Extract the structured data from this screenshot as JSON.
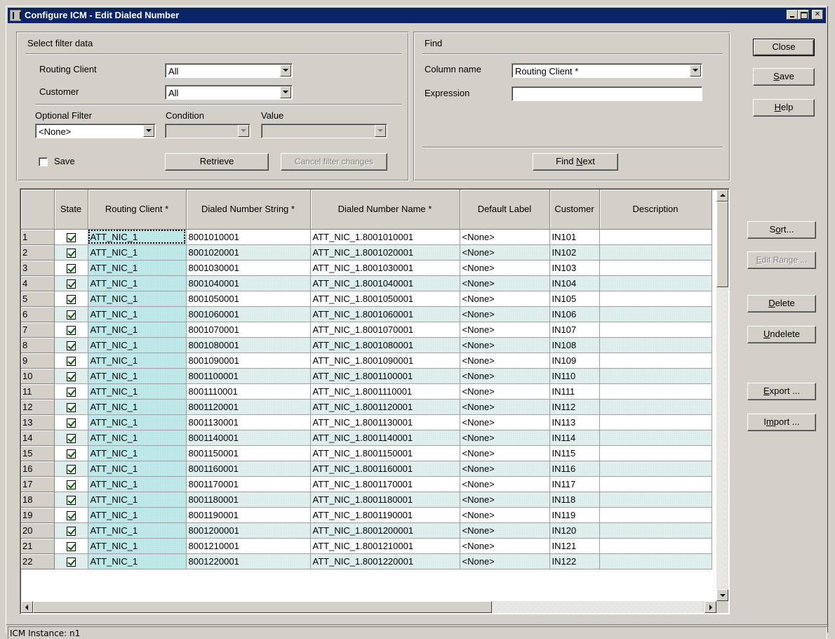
{
  "window": {
    "title": "Configure ICM - Edit Dialed Number"
  },
  "filter": {
    "group_title": "Select filter data",
    "routing_client_label": "Routing Client",
    "routing_client_value": "All",
    "customer_label": "Customer",
    "customer_value": "All",
    "optional_filter_label": "Optional Filter",
    "optional_filter_value": "<None>",
    "condition_label": "Condition",
    "condition_value": "",
    "value_label": "Value",
    "value_value": "",
    "save_label": "Save",
    "retrieve_label": "Retrieve",
    "cancel_label": "Cancel filter changes"
  },
  "find": {
    "group_title": "Find",
    "column_name_label": "Column name",
    "column_name_value": "Routing Client *",
    "expression_label": "Expression",
    "expression_value": "",
    "find_next_pre": "Find ",
    "find_next_u": "N",
    "find_next_post": "ext"
  },
  "actions": {
    "close": "Close",
    "save_u": "S",
    "save_rest": "ave",
    "help_u": "H",
    "help_rest": "elp",
    "sort_pre": "S",
    "sort_u": "o",
    "sort_post": "rt...",
    "edit_range_pre": "",
    "edit_range_u": "E",
    "edit_range_post": "dit Range ...",
    "delete_u": "D",
    "delete_rest": "elete",
    "undelete_u": "U",
    "undelete_rest": "ndelete",
    "export_u": "E",
    "export_rest": "xport ...",
    "import_pre": "I",
    "import_u": "m",
    "import_post": "port ..."
  },
  "grid": {
    "columns": [
      "",
      "State",
      "Routing Client *",
      "Dialed Number String *",
      "Dialed Number Name *",
      "Default Label",
      "Customer",
      "Description"
    ],
    "rows": [
      {
        "n": "1",
        "rc": "ATT_NIC_1",
        "dns": "8001010001",
        "dnn": "ATT_NIC_1.8001010001",
        "label": "<None>",
        "cust": "IN101",
        "desc": ""
      },
      {
        "n": "2",
        "rc": "ATT_NIC_1",
        "dns": "8001020001",
        "dnn": "ATT_NIC_1.8001020001",
        "label": "<None>",
        "cust": "IN102",
        "desc": ""
      },
      {
        "n": "3",
        "rc": "ATT_NIC_1",
        "dns": "8001030001",
        "dnn": "ATT_NIC_1.8001030001",
        "label": "<None>",
        "cust": "IN103",
        "desc": ""
      },
      {
        "n": "4",
        "rc": "ATT_NIC_1",
        "dns": "8001040001",
        "dnn": "ATT_NIC_1.8001040001",
        "label": "<None>",
        "cust": "IN104",
        "desc": ""
      },
      {
        "n": "5",
        "rc": "ATT_NIC_1",
        "dns": "8001050001",
        "dnn": "ATT_NIC_1.8001050001",
        "label": "<None>",
        "cust": "IN105",
        "desc": ""
      },
      {
        "n": "6",
        "rc": "ATT_NIC_1",
        "dns": "8001060001",
        "dnn": "ATT_NIC_1.8001060001",
        "label": "<None>",
        "cust": "IN106",
        "desc": ""
      },
      {
        "n": "7",
        "rc": "ATT_NIC_1",
        "dns": "8001070001",
        "dnn": "ATT_NIC_1.8001070001",
        "label": "<None>",
        "cust": "IN107",
        "desc": ""
      },
      {
        "n": "8",
        "rc": "ATT_NIC_1",
        "dns": "8001080001",
        "dnn": "ATT_NIC_1.8001080001",
        "label": "<None>",
        "cust": "IN108",
        "desc": ""
      },
      {
        "n": "9",
        "rc": "ATT_NIC_1",
        "dns": "8001090001",
        "dnn": "ATT_NIC_1.8001090001",
        "label": "<None>",
        "cust": "IN109",
        "desc": ""
      },
      {
        "n": "10",
        "rc": "ATT_NIC_1",
        "dns": "8001100001",
        "dnn": "ATT_NIC_1.8001100001",
        "label": "<None>",
        "cust": "IN110",
        "desc": ""
      },
      {
        "n": "11",
        "rc": "ATT_NIC_1",
        "dns": "8001110001",
        "dnn": "ATT_NIC_1.8001110001",
        "label": "<None>",
        "cust": "IN111",
        "desc": ""
      },
      {
        "n": "12",
        "rc": "ATT_NIC_1",
        "dns": "8001120001",
        "dnn": "ATT_NIC_1.8001120001",
        "label": "<None>",
        "cust": "IN112",
        "desc": ""
      },
      {
        "n": "13",
        "rc": "ATT_NIC_1",
        "dns": "8001130001",
        "dnn": "ATT_NIC_1.8001130001",
        "label": "<None>",
        "cust": "IN113",
        "desc": ""
      },
      {
        "n": "14",
        "rc": "ATT_NIC_1",
        "dns": "8001140001",
        "dnn": "ATT_NIC_1.8001140001",
        "label": "<None>",
        "cust": "IN114",
        "desc": ""
      },
      {
        "n": "15",
        "rc": "ATT_NIC_1",
        "dns": "8001150001",
        "dnn": "ATT_NIC_1.8001150001",
        "label": "<None>",
        "cust": "IN115",
        "desc": ""
      },
      {
        "n": "16",
        "rc": "ATT_NIC_1",
        "dns": "8001160001",
        "dnn": "ATT_NIC_1.8001160001",
        "label": "<None>",
        "cust": "IN116",
        "desc": ""
      },
      {
        "n": "17",
        "rc": "ATT_NIC_1",
        "dns": "8001170001",
        "dnn": "ATT_NIC_1.8001170001",
        "label": "<None>",
        "cust": "IN117",
        "desc": ""
      },
      {
        "n": "18",
        "rc": "ATT_NIC_1",
        "dns": "8001180001",
        "dnn": "ATT_NIC_1.8001180001",
        "label": "<None>",
        "cust": "IN118",
        "desc": ""
      },
      {
        "n": "19",
        "rc": "ATT_NIC_1",
        "dns": "8001190001",
        "dnn": "ATT_NIC_1.8001190001",
        "label": "<None>",
        "cust": "IN119",
        "desc": ""
      },
      {
        "n": "20",
        "rc": "ATT_NIC_1",
        "dns": "8001200001",
        "dnn": "ATT_NIC_1.8001200001",
        "label": "<None>",
        "cust": "IN120",
        "desc": ""
      },
      {
        "n": "21",
        "rc": "ATT_NIC_1",
        "dns": "8001210001",
        "dnn": "ATT_NIC_1.8001210001",
        "label": "<None>",
        "cust": "IN121",
        "desc": ""
      },
      {
        "n": "22",
        "rc": "ATT_NIC_1",
        "dns": "8001220001",
        "dnn": "ATT_NIC_1.8001220001",
        "label": "<None>",
        "cust": "IN122",
        "desc": ""
      }
    ]
  },
  "status": {
    "instance": "ICM Instance: n1"
  },
  "colors": {
    "titlebar": "#0a246a",
    "face": "#d4d0c8",
    "row_alt": "#e2f0f0",
    "routing_client_col": "#c2eaea",
    "check": "#006000"
  }
}
